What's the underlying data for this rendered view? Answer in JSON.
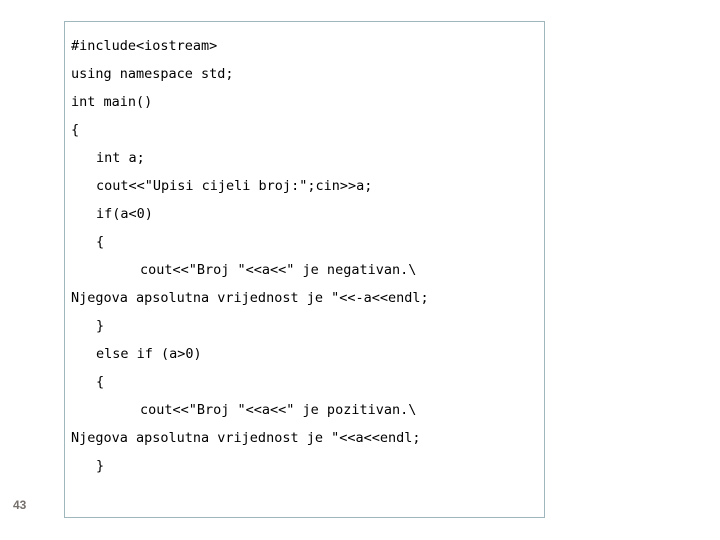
{
  "slide": {
    "number": "43",
    "background_color": "#ffffff"
  },
  "code_box": {
    "border_color": "#9fb6bd",
    "background_color": "#ffffff",
    "language": "cpp",
    "text_color": "#000000",
    "lines": [
      {
        "indent": 0,
        "text": "#include<iostream>"
      },
      {
        "indent": 0,
        "text": "using namespace std;"
      },
      {
        "indent": 0,
        "text": "int main()"
      },
      {
        "indent": 0,
        "text": "{"
      },
      {
        "indent": 1,
        "text": "int a;"
      },
      {
        "indent": 1,
        "text": "cout<<\"Upisi cijeli broj:\";cin>>a;"
      },
      {
        "indent": 1,
        "text": "if(a<0)"
      },
      {
        "indent": 1,
        "text": "{"
      },
      {
        "indent": 2,
        "text": "cout<<\"Broj \"<<a<<\" je negativan.\\"
      },
      {
        "indent": 0,
        "text": "Njegova apsolutna vrijednost je \"<<-a<<endl;"
      },
      {
        "indent": 1,
        "text": "}"
      },
      {
        "indent": 1,
        "text": "else if (a>0)"
      },
      {
        "indent": 1,
        "text": "{"
      },
      {
        "indent": 2,
        "text": "cout<<\"Broj \"<<a<<\" je pozitivan.\\"
      },
      {
        "indent": 0,
        "text": "Njegova apsolutna vrijednost je \"<<a<<endl;"
      },
      {
        "indent": 1,
        "text": "}"
      }
    ]
  }
}
